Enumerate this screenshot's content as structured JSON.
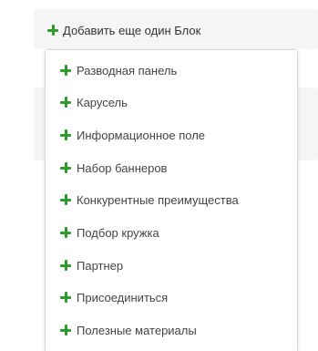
{
  "add_block": {
    "label": "Добавить еще один Блок",
    "icon": "plus-icon"
  },
  "menu": {
    "items": [
      {
        "label": "Разводная панель"
      },
      {
        "label": "Карусель"
      },
      {
        "label": "Информационное поле"
      },
      {
        "label": "Набор баннеров"
      },
      {
        "label": "Конкурентные преимущества"
      },
      {
        "label": "Подбор кружка"
      },
      {
        "label": "Партнер"
      },
      {
        "label": "Присоединиться"
      },
      {
        "label": "Полезные материалы"
      }
    ]
  },
  "colors": {
    "accent": "#2e9b2e",
    "panel_bg": "#f5f5f5",
    "text": "#333333"
  }
}
